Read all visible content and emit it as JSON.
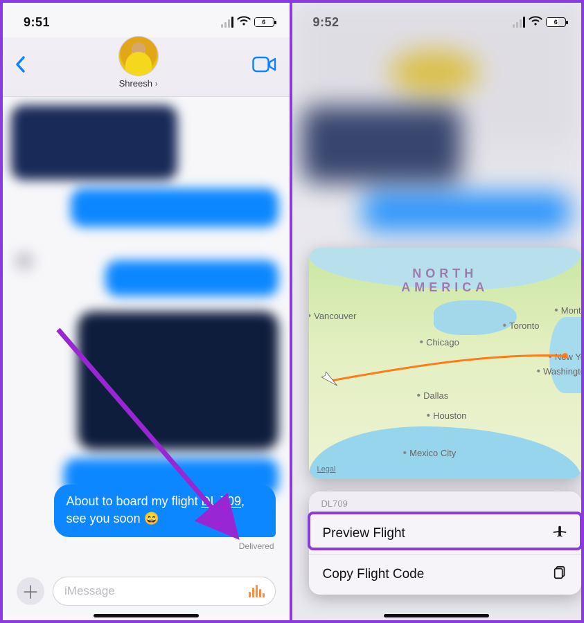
{
  "left": {
    "status": {
      "time": "9:51",
      "battery": "6"
    },
    "nav": {
      "contact_name": "Shreesh"
    },
    "message": {
      "prefix": "About to board my flight ",
      "flight_code": "DL 709",
      "suffix": ", see you soon 😄",
      "status": "Delivered"
    },
    "composer": {
      "placeholder": "iMessage"
    }
  },
  "right": {
    "status": {
      "time": "9:52",
      "battery": "6"
    },
    "map": {
      "region_line1": "NORTH",
      "region_line2": "AMERICA",
      "legal": "Legal",
      "cities": {
        "vancouver": "Vancouver",
        "chicago": "Chicago",
        "toronto": "Toronto",
        "montreal": "Montr",
        "newyork": "New Yo",
        "washington": "Washingto",
        "dallas": "Dallas",
        "houston": "Houston",
        "mexicocity": "Mexico City"
      }
    },
    "menu": {
      "header": "DL709",
      "preview": "Preview Flight",
      "copy": "Copy Flight Code"
    }
  }
}
